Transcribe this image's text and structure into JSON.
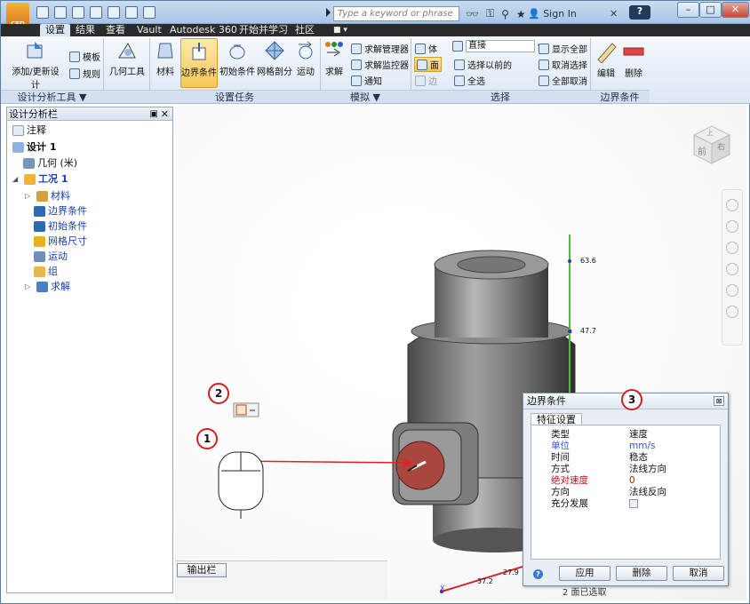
{
  "qat": {
    "search_placeholder": "Type a keyword or phrase",
    "sign_in": "Sign In"
  },
  "tabs": [
    "设置",
    "结果",
    "查看",
    "Vault",
    "Autodesk 360",
    "开始并学习",
    "社区"
  ],
  "ribbon": {
    "btn_add_update": "添加/更新设计",
    "btn_template": "模板",
    "btn_rules": "规则",
    "btn_geometry_tools": "几何工具",
    "btn_material": "材料",
    "btn_boundary": "边界条件",
    "btn_initial": "初始条件",
    "btn_mesh": "网格剖分",
    "btn_motion": "运动",
    "btn_solve": "求解",
    "btn_solve_manager": "求解管理器",
    "btn_solve_monitor": "求解监控器",
    "btn_notify": "通知",
    "btn_body": "体",
    "btn_face": "面",
    "btn_edge": "边",
    "select_direct": "直接",
    "btn_select_prev": "选择以前的",
    "btn_select_all": "全选",
    "btn_show_all": "显示全部",
    "btn_cancel_select": "取消选择",
    "btn_cancel_all": "全部取消",
    "btn_edit": "编辑",
    "btn_delete": "删除",
    "group_design_tools": "设计分析工具 ▼",
    "group_setup_tasks": "设置任务",
    "group_simulation": "模拟 ▼",
    "group_selection": "选择",
    "group_boundary": "边界条件"
  },
  "panel": {
    "title": "设计分析栏",
    "items": [
      "注释",
      "设计 1",
      "几何 (米)",
      "工况 1",
      "材料",
      "边界条件",
      "初始条件",
      "网格尺寸",
      "运动",
      "组",
      "求解"
    ]
  },
  "output_tab": "输出栏",
  "axis_labels": [
    "63.6",
    "47.7",
    "37.2",
    "27.9"
  ],
  "axis_letter": "X",
  "bottom_text": "2 面已选取",
  "viewcube": {
    "front": "前",
    "right": "右",
    "top": "上"
  },
  "dialog": {
    "title": "边界条件",
    "section": "特征设置",
    "rows": [
      {
        "k": "类型",
        "v": "速度"
      },
      {
        "k": "单位",
        "v": "mm/s"
      },
      {
        "k": "时间",
        "v": "稳态"
      },
      {
        "k": "方式",
        "v": "法线方向"
      },
      {
        "k": "绝对速度",
        "v": "0"
      },
      {
        "k": "方向",
        "v": "法线反向"
      },
      {
        "k": "充分发展",
        "v": ""
      }
    ],
    "btn_apply": "应用",
    "btn_delete": "删除",
    "btn_cancel": "取消"
  },
  "callouts": [
    "1",
    "2",
    "3"
  ]
}
